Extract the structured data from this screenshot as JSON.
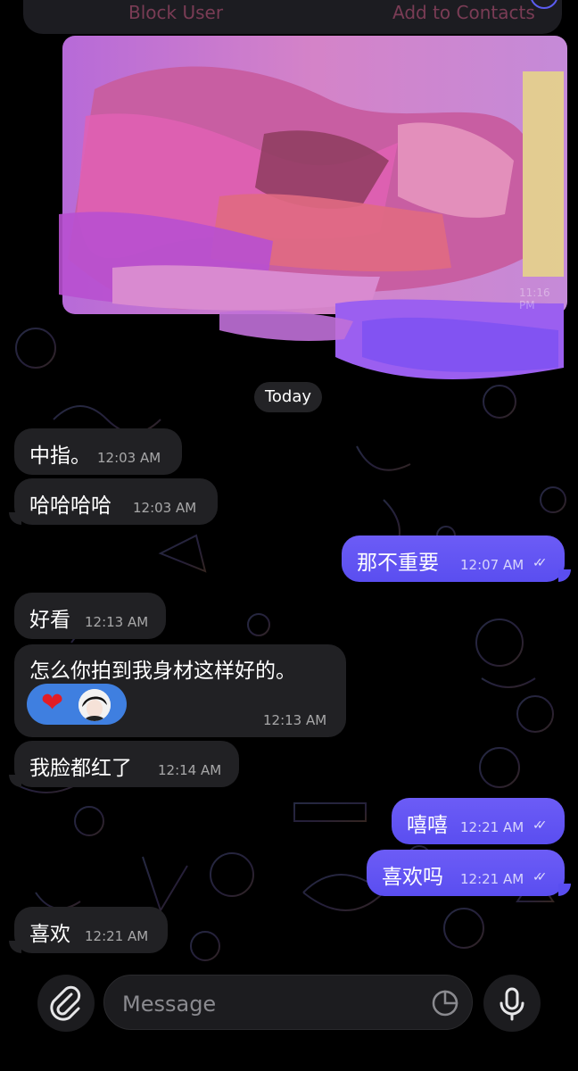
{
  "header": {
    "left_label": "Block User",
    "right_label": "Add to Contacts"
  },
  "media": {
    "time": "11:16 PM"
  },
  "date_divider": "Today",
  "messages": [
    {
      "dir": "in",
      "text": "中指。",
      "time": "12:03 AM"
    },
    {
      "dir": "in",
      "text": "哈哈哈哈",
      "time": "12:03 AM"
    },
    {
      "dir": "out",
      "text": "那不重要",
      "time": "12:07 AM"
    },
    {
      "dir": "in",
      "text": "好看",
      "time": "12:13 AM"
    },
    {
      "dir": "in",
      "text": "怎么你拍到我身材这样好的。",
      "time": "12:13 AM",
      "reaction": "❤"
    },
    {
      "dir": "in",
      "text": "我脸都红了",
      "time": "12:14 AM"
    },
    {
      "dir": "out",
      "text": "嘻嘻",
      "time": "12:21 AM"
    },
    {
      "dir": "out",
      "text": "喜欢吗",
      "time": "12:21 AM"
    },
    {
      "dir": "in",
      "text": "喜欢",
      "time": "12:21 AM"
    }
  ],
  "composer": {
    "placeholder": "Message",
    "attach_icon": "paperclip-icon",
    "sticker_icon": "sticker-icon",
    "mic_icon": "microphone-icon"
  },
  "colors": {
    "outgoing": "#5a4ef0",
    "incoming": "#212124",
    "background": "#000000"
  }
}
